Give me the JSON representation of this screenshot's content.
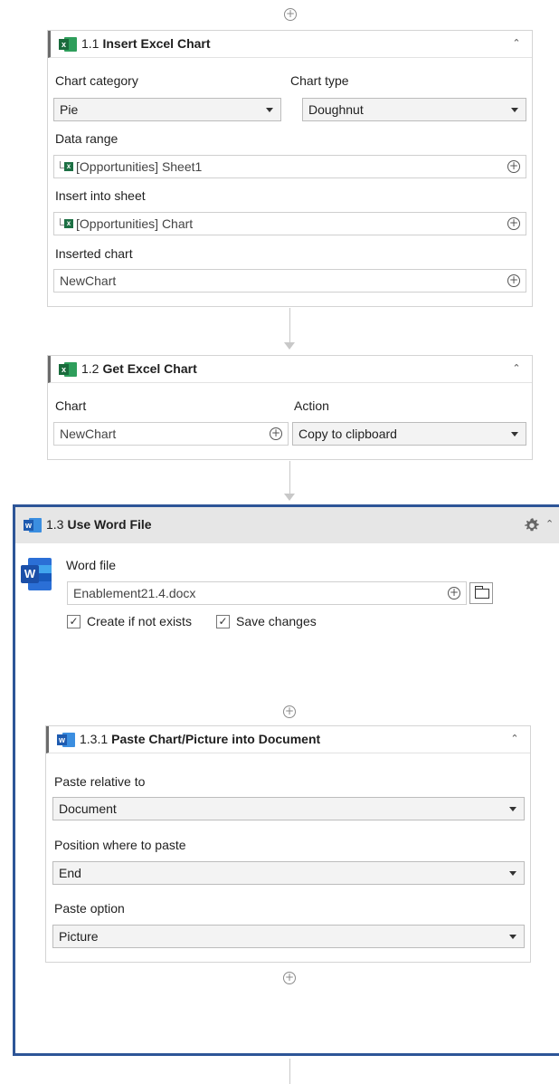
{
  "steps": [
    {
      "number": "1.1",
      "title": "Insert Excel Chart",
      "chart_category_label": "Chart category",
      "chart_category_value": "Pie",
      "chart_type_label": "Chart type",
      "chart_type_value": "Doughnut",
      "data_range_label": "Data range",
      "data_range_value": "[Opportunities] Sheet1",
      "insert_sheet_label": "Insert into sheet",
      "insert_sheet_value": "[Opportunities] Chart",
      "inserted_chart_label": "Inserted chart",
      "inserted_chart_value": "NewChart"
    },
    {
      "number": "1.2",
      "title": "Get Excel Chart",
      "chart_label": "Chart",
      "chart_value": "NewChart",
      "action_label": "Action",
      "action_value": "Copy to clipboard"
    },
    {
      "number": "1.3",
      "title": "Use Word File",
      "word_file_label": "Word file",
      "word_file_value": "Enablement21.4.docx",
      "create_if_not_exists_label": "Create if not exists",
      "create_if_not_exists_checked": true,
      "save_changes_label": "Save changes",
      "save_changes_checked": true
    },
    {
      "number": "1.3.1",
      "title": "Paste Chart/Picture into Document",
      "paste_relative_label": "Paste relative to",
      "paste_relative_value": "Document",
      "position_label": "Position where to paste",
      "position_value": "End",
      "paste_option_label": "Paste option",
      "paste_option_value": "Picture"
    }
  ],
  "icons": {
    "add": "plus-circle-icon",
    "collapse": "chevron-up-icon",
    "dropdown": "caret-down-icon",
    "excel": "excel-icon",
    "word": "word-icon",
    "settings": "gear-icon",
    "browse": "folder-icon",
    "check": "checkmark-icon"
  },
  "colors": {
    "word_container_border": "#2d5597",
    "excel_green": "#1d7044",
    "word_blue": "#2b6fd6"
  }
}
